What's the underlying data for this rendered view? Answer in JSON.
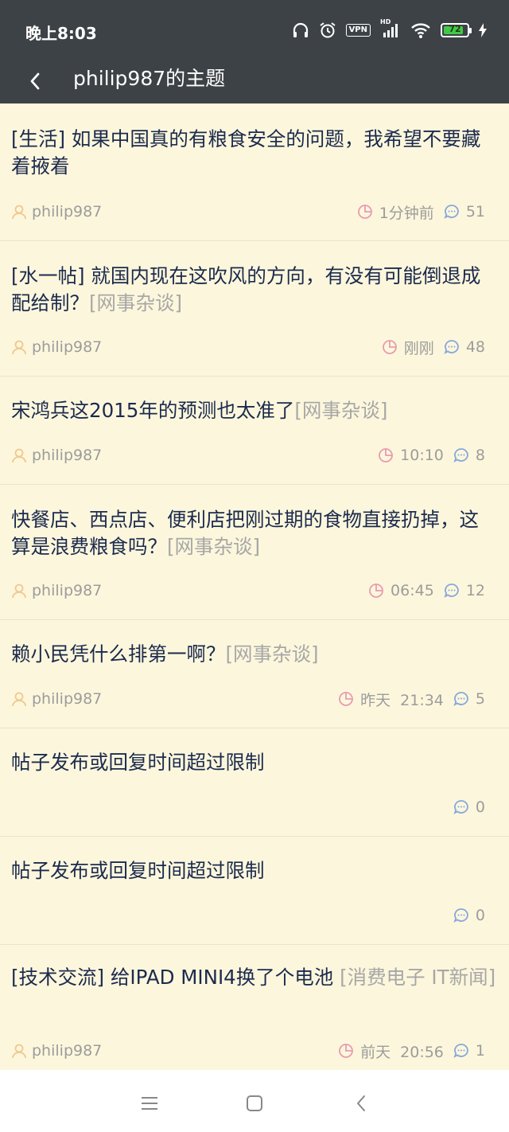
{
  "status_bar": {
    "time": "晚上8:03",
    "vpn_label": "VPN",
    "signal_label": "HD",
    "battery": "72",
    "icons": [
      "headphones-icon",
      "alarm-icon",
      "vpn-icon",
      "signal-icon",
      "wifi-icon",
      "battery-icon",
      "charging-icon"
    ]
  },
  "toolbar": {
    "title": "philip987的主题",
    "back_icon": "back-arrow-icon"
  },
  "colors": {
    "bar_bg": "#3d4246",
    "page_bg": "#fcf7dc",
    "title_text": "#1c2a4e",
    "tag_text": "#a7a7a7",
    "user_icon": "#f3c68d",
    "clock_icon": "#e99ab2",
    "comment_icon": "#87a7dd"
  },
  "topics": [
    {
      "title": "[生活] 如果中国真的有粮食安全的问题，我希望不要藏着掖着",
      "tag": "",
      "author": "philip987",
      "time": "1分钟前",
      "replies": "51"
    },
    {
      "title": "[水一帖] 就国内现在这吹风的方向，有没有可能倒退成配给制？",
      "tag": "[网事杂谈]",
      "author": "philip987",
      "time": "刚刚",
      "replies": "48"
    },
    {
      "title": "宋鸿兵这2015年的预测也太准了",
      "tag": "[网事杂谈]",
      "author": "philip987",
      "time": "10:10",
      "replies": "8"
    },
    {
      "title": "快餐店、西点店、便利店把刚过期的食物直接扔掉，这算是浪费粮食吗？",
      "tag": "[网事杂谈]",
      "author": "philip987",
      "time": "06:45",
      "replies": "12"
    },
    {
      "title": "赖小民凭什么排第一啊？",
      "tag": "[网事杂谈]",
      "author": "philip987",
      "time": "昨天  21:34",
      "replies": "5"
    },
    {
      "title": "帖子发布或回复时间超过限制",
      "tag": "",
      "author": "",
      "time": "",
      "replies": "0"
    },
    {
      "title": "帖子发布或回复时间超过限制",
      "tag": "",
      "author": "",
      "time": "",
      "replies": "0"
    },
    {
      "title": "[技术交流] 给IPAD MINI4换了个电池",
      "tag": "[消费电子 IT新闻]",
      "author": "philip987",
      "time": "前天  20:56",
      "replies": "1"
    }
  ],
  "nav_bar": {
    "icons": [
      "menu-icon",
      "home-icon",
      "back-icon"
    ]
  }
}
